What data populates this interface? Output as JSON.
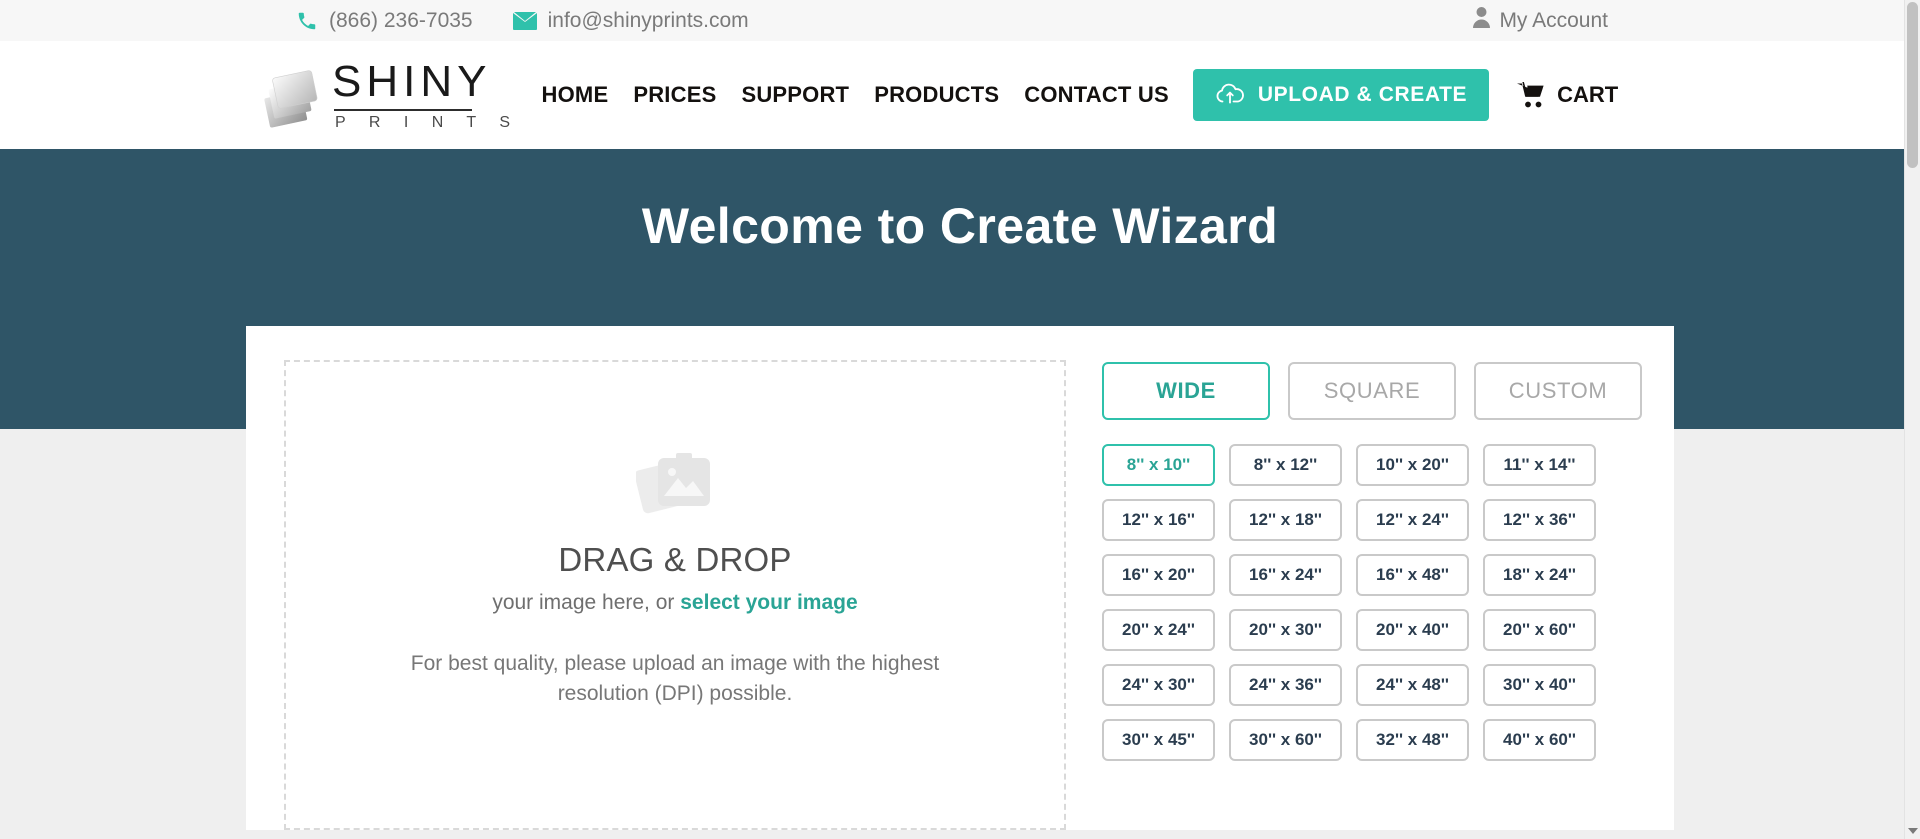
{
  "topbar": {
    "phone": "(866) 236-7035",
    "email": "info@shinyprints.com",
    "account": "My Account",
    "phone_icon": "phone-icon",
    "email_icon": "envelope-icon",
    "account_icon": "user-icon"
  },
  "logo": {
    "primary": "SHINY",
    "secondary": "P R I N T S",
    "mark_icon": "stacked-prints-icon"
  },
  "nav": {
    "items": [
      {
        "label": "HOME"
      },
      {
        "label": "PRICES"
      },
      {
        "label": "SUPPORT"
      },
      {
        "label": "PRODUCTS"
      },
      {
        "label": "CONTACT US"
      }
    ],
    "upload_button": "UPLOAD & CREATE",
    "upload_icon": "cloud-upload-icon",
    "cart_label": "CART",
    "cart_icon": "shopping-cart-icon"
  },
  "hero": {
    "title": "Welcome to Create Wizard"
  },
  "dropzone": {
    "placeholder_icon": "image-placeholder-icon",
    "title": "DRAG & DROP",
    "subtitle_prefix": "your image here, or ",
    "subtitle_link": "select your image",
    "note": "For best quality, please upload an image with the highest resolution (DPI) possible."
  },
  "shape_tabs": [
    {
      "label": "WIDE",
      "active": true
    },
    {
      "label": "SQUARE",
      "active": false
    },
    {
      "label": "CUSTOM",
      "active": false
    }
  ],
  "sizes": [
    {
      "label": "8'' x 10''",
      "selected": true
    },
    {
      "label": "8'' x 12''",
      "selected": false
    },
    {
      "label": "10'' x 20''",
      "selected": false
    },
    {
      "label": "11'' x 14''",
      "selected": false
    },
    {
      "label": "12'' x 16''",
      "selected": false
    },
    {
      "label": "12'' x 18''",
      "selected": false
    },
    {
      "label": "12'' x 24''",
      "selected": false
    },
    {
      "label": "12'' x 36''",
      "selected": false
    },
    {
      "label": "16'' x 20''",
      "selected": false
    },
    {
      "label": "16'' x 24''",
      "selected": false
    },
    {
      "label": "16'' x 48''",
      "selected": false
    },
    {
      "label": "18'' x 24''",
      "selected": false
    },
    {
      "label": "20'' x 24''",
      "selected": false
    },
    {
      "label": "20'' x 30''",
      "selected": false
    },
    {
      "label": "20'' x 40''",
      "selected": false
    },
    {
      "label": "20'' x 60''",
      "selected": false
    },
    {
      "label": "24'' x 30''",
      "selected": false
    },
    {
      "label": "24'' x 36''",
      "selected": false
    },
    {
      "label": "24'' x 48''",
      "selected": false
    },
    {
      "label": "30'' x 40''",
      "selected": false
    },
    {
      "label": "30'' x 45''",
      "selected": false
    },
    {
      "label": "30'' x 60''",
      "selected": false
    },
    {
      "label": "32'' x 48''",
      "selected": false
    },
    {
      "label": "40'' x 60''",
      "selected": false
    }
  ],
  "colors": {
    "accent": "#2fc1ab",
    "accent_text": "#2aa495",
    "hero_bg": "#2f5567",
    "topbar_bg": "#f7f7f7",
    "page_bg": "#efefef",
    "size_text": "#2b3d4f"
  }
}
